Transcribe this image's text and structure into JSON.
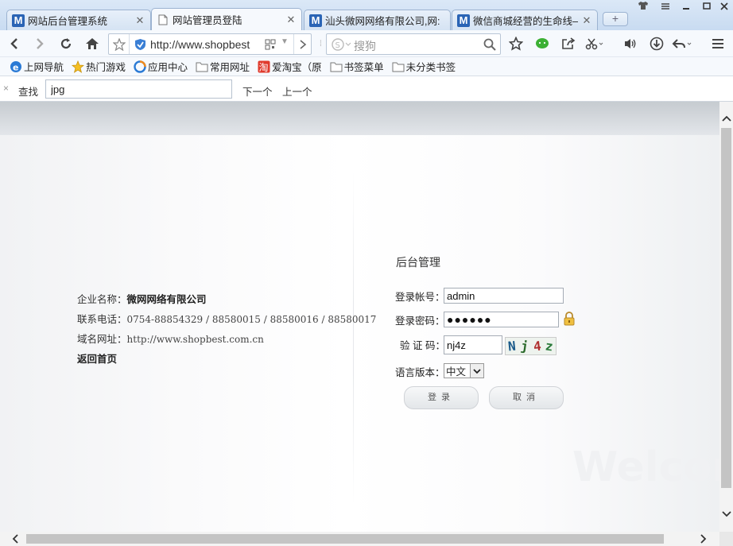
{
  "tabs": [
    {
      "title": "网站后台管理系统",
      "icon": "site-m-icon"
    },
    {
      "title": "网站管理员登陆",
      "icon": "page-icon",
      "active": true
    },
    {
      "title": "汕头微网网络有限公司,网:",
      "icon": "site-m-icon"
    },
    {
      "title": "微信商城经营的生命线——",
      "icon": "site-m-icon"
    }
  ],
  "newtab_label": "+",
  "address": {
    "url": "http://www.shopbest"
  },
  "search": {
    "placeholder": "搜狗"
  },
  "bookmarks": [
    {
      "label": "上网导航",
      "icon": "ie-icon"
    },
    {
      "label": "热门游戏",
      "icon": "star-icon"
    },
    {
      "label": "应用中心",
      "icon": "app-center-icon"
    },
    {
      "label": "常用网址",
      "icon": "folder-icon"
    },
    {
      "label": "爱淘宝（原",
      "icon": "taobao-icon"
    },
    {
      "label": "书签菜单",
      "icon": "folder-icon"
    },
    {
      "label": "未分类书签",
      "icon": "folder-icon"
    }
  ],
  "findbar": {
    "close": "×",
    "label": "查找",
    "value": "jpg",
    "next": "下一个",
    "prev": "上一个"
  },
  "company": {
    "name_label": "企业名称：",
    "name": "微网网络有限公司",
    "phone_label": "联系电话：",
    "phone": "0754-88854329 / 88580015 / 88580016 / 88580017",
    "domain_label": "域名网址：",
    "domain": "http://www.shopbest.com.cn",
    "back_home": "返回首页"
  },
  "login": {
    "title": "后台管理",
    "account_label": "登录帐号：",
    "account_value": "admin",
    "password_label": "登录密码：",
    "password_value": "●●●●●●",
    "captcha_label": "验 证 码：",
    "captcha_value": "nj4z",
    "captcha_chars": [
      "N",
      "j",
      "4",
      "z"
    ],
    "captcha_colors": [
      "#1a5a8a",
      "#2a6a2a",
      "#b03030",
      "#2a7a3a"
    ],
    "language_label": "语言版本：",
    "language_value": "中文",
    "submit": "登录",
    "cancel": "取消"
  },
  "watermark": "Welcom"
}
